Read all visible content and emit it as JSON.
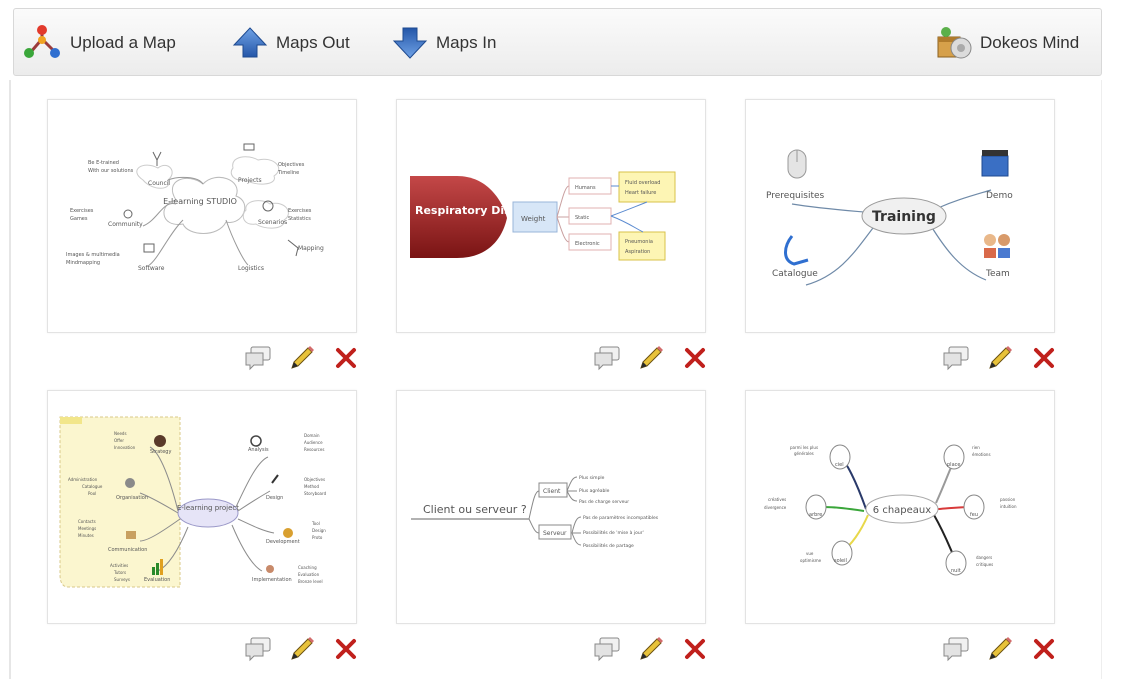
{
  "toolbar": {
    "upload_label": "Upload a Map",
    "maps_out_label": "Maps Out",
    "maps_in_label": "Maps In",
    "brand_label": "Dokeos Mind",
    "icons": [
      "upload-map-icon",
      "arrow-up-icon",
      "arrow-down-icon",
      "dokeos-mind-icon"
    ]
  },
  "colors": {
    "arrow_blue": "#3a6fc4",
    "delete_red": "#c0201c",
    "accent_dark_red": "#9a1e1e"
  },
  "maps": [
    {
      "center": "E-learning STUDIO",
      "nodes": [
        "Council",
        "Projects",
        "Community",
        "Scenarios",
        "Software",
        "Logistics",
        "Mapping"
      ],
      "details": [
        "Be E-trained",
        "With our solutions",
        "Objectives",
        "Timeline",
        "Exercises",
        "Games",
        "Exercises",
        "Statistics",
        "Images & multimedia",
        "Mindmapping"
      ]
    },
    {
      "center": "Respiratory Distress",
      "nodes": [
        "Weight",
        "Humans",
        "Static",
        "Electronic"
      ],
      "details": [
        "Fluid overload",
        "Heart failure",
        "Pneumonia",
        "Aspiration"
      ]
    },
    {
      "center": "Training",
      "nodes": [
        "Prerequisites",
        "Demo",
        "Catalogue",
        "Team"
      ]
    },
    {
      "center": "E-learning project",
      "nodes": [
        "Strategy",
        "Organisation",
        "Communication",
        "Evaluation",
        "Analysis",
        "Design",
        "Development",
        "Implementation"
      ],
      "details": [
        "Needs",
        "Offer",
        "Innovation",
        "Administration",
        "Catalogue",
        "Pool",
        "Contacts",
        "Meetings",
        "Minutes",
        "Activities",
        "Tutors",
        "Surveys",
        "Domain",
        "Audience",
        "Resources",
        "Objectives",
        "Method",
        "Storyboard",
        "Tool",
        "Design",
        "Proto",
        "Coaching",
        "Evaluation",
        "Bronze level"
      ]
    },
    {
      "center": "Client ou serveur ?",
      "nodes": [
        "Client",
        "Serveur"
      ],
      "details": [
        "Plus simple",
        "Plus agréable",
        "Pas de charge serveur",
        "Pas de paramètres incompatibles",
        "Possibilités de 'mise à jour'",
        "Possibilités de partage"
      ]
    },
    {
      "center": "6 chapeaux",
      "nodes": [
        "ciel",
        "arbre",
        "soleil",
        "place",
        "feu",
        "nuit"
      ],
      "details": [
        "parmi les plus",
        "générales",
        "créatives",
        "divergence",
        "vue",
        "optimisme",
        "rien",
        "émotions",
        "passion",
        "intuition",
        "dangers",
        "critiques"
      ]
    }
  ],
  "card_actions": [
    "comment-icon",
    "edit-pencil-icon",
    "delete-x-icon"
  ]
}
